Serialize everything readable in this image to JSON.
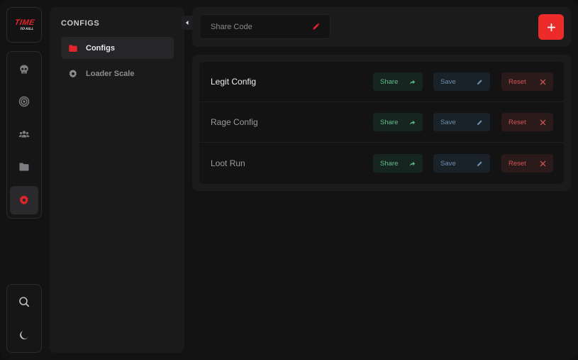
{
  "logo": {
    "main": "TIME",
    "sub": "TO KILL"
  },
  "rail": {
    "top_items": [
      {
        "icon": "skull-icon"
      },
      {
        "icon": "target-icon"
      },
      {
        "icon": "users-icon"
      },
      {
        "icon": "folder-icon"
      },
      {
        "icon": "gear-icon",
        "active": true
      }
    ],
    "bottom_items": [
      {
        "icon": "search-icon"
      },
      {
        "icon": "moon-icon"
      }
    ]
  },
  "sidebar": {
    "title": "CONFIGS",
    "items": [
      {
        "label": "Configs",
        "icon": "folder-icon",
        "active": true
      },
      {
        "label": "Loader Scale",
        "icon": "gear-icon",
        "active": false
      }
    ]
  },
  "topbar": {
    "share_placeholder": "Share Code",
    "add_icon": "plus-icon"
  },
  "configs": [
    {
      "name": "Legit Config",
      "share": "Share",
      "save": "Save",
      "reset": "Reset"
    },
    {
      "name": "Rage Config",
      "share": "Share",
      "save": "Save",
      "reset": "Reset"
    },
    {
      "name": "Loot Run",
      "share": "Share",
      "save": "Save",
      "reset": "Reset"
    }
  ],
  "colors": {
    "accent": "#ee2b2b",
    "share_text": "#5fbf8b",
    "save_text": "#6d8fb0",
    "reset_text": "#d55555"
  }
}
